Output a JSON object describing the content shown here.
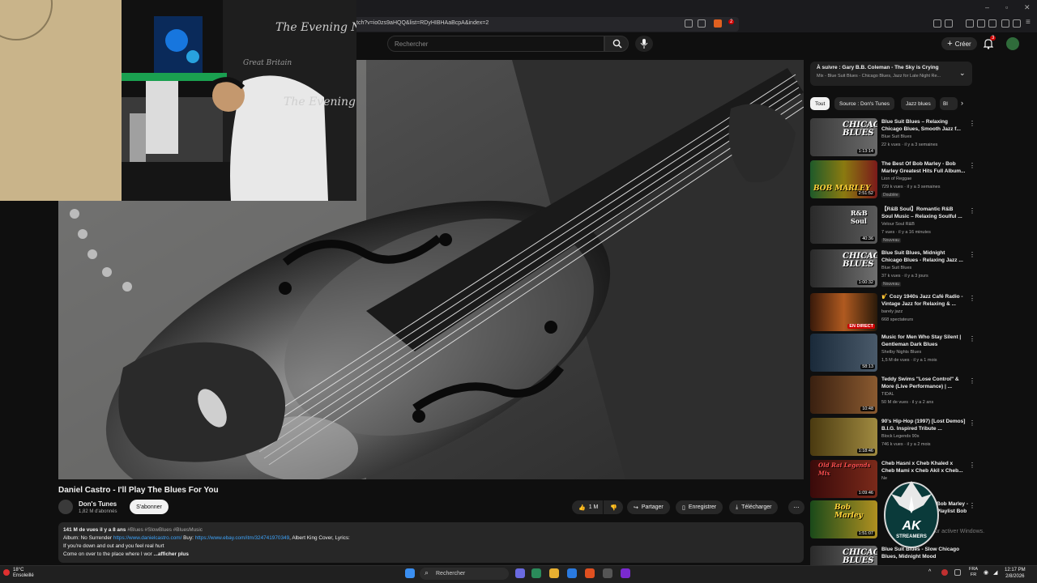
{
  "browser": {
    "url": "tch?v=io0zs9aHQQ&list=RDyHIBHAaBcpA&index=2",
    "badge_count": "2"
  },
  "header": {
    "search_placeholder": "Rechercher",
    "create_label": "Créer",
    "notification_count": "3"
  },
  "video": {
    "title": "Daniel Castro - I'll Play The Blues For You",
    "channel": "Don's Tunes",
    "subscribers": "1,82 M d'abonnés",
    "subscribe_label": "S'abonner",
    "likes": "1 M",
    "share_label": "Partager",
    "save_label": "Enregistrer",
    "download_label": "Télécharger",
    "webcam_text_1": "The Evening News",
    "webcam_text_2": "Great Britain",
    "webcam_text_3": "The Evening N"
  },
  "description": {
    "views_age": "141 M de vues  il y a 8 ans",
    "hashtags": "#Blues #SlowBlues #BluesMusic",
    "line2_prefix": "Album: No Surrender",
    "link1": "https://www.danielcastro.com/",
    "line2_mid": " Buy:",
    "link2": "https://www.ebay.com/itm/324741970349",
    "line2_suffix": ", Albert King Cover, Lyrics:",
    "line3": "If you're down and out and you feel real hurt",
    "line4": "Come on over to the place where I wor",
    "show_more": "...afficher plus"
  },
  "sidebar": {
    "upnext_title": "À suivre : Gary B.B. Coleman - The Sky is Crying",
    "upnext_sub": "Mix - Blue Suit Blues - Chicago Blues, Jazz for Late Night Re...",
    "chips": [
      "Tout",
      "Source : Don's Tunes",
      "Jazz blues",
      "Bl"
    ],
    "recs": [
      {
        "title": "Blue Suit Blues – Relaxing Chicago Blues, Smooth Jazz f...",
        "channel": "Blue Suit Blues",
        "meta": "22 k vues · il y a 3 semaines",
        "duration": "1:13:14",
        "thumbtext": "CHICAGO BLUES",
        "badge": ""
      },
      {
        "title": "The Best Of Bob Marley - Bob Marley Greatest Hits Full Album...",
        "channel": "Lion of Reggae",
        "meta": "729 k vues · il y a 3 semaines",
        "duration": "2:51:52",
        "thumbtext": "BOB MARLEY",
        "badge": "Doublée"
      },
      {
        "title": "【R&B Soul】Romantic R&B Soul Music – Relaxing Soulful ...",
        "channel": "Velour Soul R&B",
        "meta": "7 vues · il y a 16 minutes",
        "duration": "40:36",
        "thumbtext": "R&B Soul",
        "badge": "Nouveau"
      },
      {
        "title": "Blue Suit Blues, Midnight Chicago Blues - Relaxing Jazz ...",
        "channel": "Blue Suit Blues",
        "meta": "37 k vues · il y a 3 jours",
        "duration": "1:00:32",
        "thumbtext": "CHICAGO BLUES",
        "badge": "Nouveau"
      },
      {
        "title": "🎷 Cozy 1940s Jazz Café Radio - Vintage Jazz for Relaxing & ...",
        "channel": "barely jazz",
        "meta": "668 spectateurs",
        "duration": "EN DIRECT",
        "thumbtext": "",
        "badge": ""
      },
      {
        "title": "Music for Men Who Stay Silent | Gentleman Dark Blues",
        "channel": "Shelby Nights Blues",
        "meta": "1,5 M de vues · il y a 1 mois",
        "duration": "58:13",
        "thumbtext": "",
        "badge": ""
      },
      {
        "title": "Teddy Swims \"Lose Control\" & More (Live Performance) | ...",
        "channel": "TIDAL",
        "meta": "50 M de vues · il y a 2 ans",
        "duration": "10:48",
        "thumbtext": "",
        "badge": ""
      },
      {
        "title": "90's Hip-Hop (1997) [Lost Demos] B.I.G. Inspired Tribute ...",
        "channel": "Block Legends 90s",
        "meta": "746 k vues · il y a 2 mois",
        "duration": "1:18:46",
        "thumbtext": "",
        "badge": ""
      },
      {
        "title": "Cheb Hasni x Cheb Khaled x Cheb Mami x Cheb Akil x Cheb...",
        "channel": "Ne",
        "meta": "",
        "duration": "1:09:46",
        "thumbtext": "Old Rai Legends Mix",
        "badge": ""
      },
      {
        "title": "Bob Marley - Playlist Bob ...",
        "channel": "",
        "meta": "",
        "duration": "1:51:07",
        "thumbtext": "Bob Marley",
        "badge": ""
      },
      {
        "title": "Blue Suit Blues - Slow Chicago Blues, Midnight Mood",
        "channel": "",
        "meta": "",
        "duration": "",
        "thumbtext": "CHICAGO BLUES",
        "badge": ""
      }
    ]
  },
  "overlay": {
    "logo_text": "AK",
    "logo_sub": "STREAMERS",
    "watermark": "ur activer Windows."
  },
  "taskbar": {
    "temp": "18°C",
    "weather": "Ensoleillé",
    "search_label": "Rechercher",
    "lang1": "FRA",
    "lang2": "FR",
    "time": "12:17 PM",
    "date": "2/8/2026"
  },
  "colors": {
    "bg": "#0f0f0f",
    "link": "#3ea6ff",
    "live": "#cc0000"
  }
}
